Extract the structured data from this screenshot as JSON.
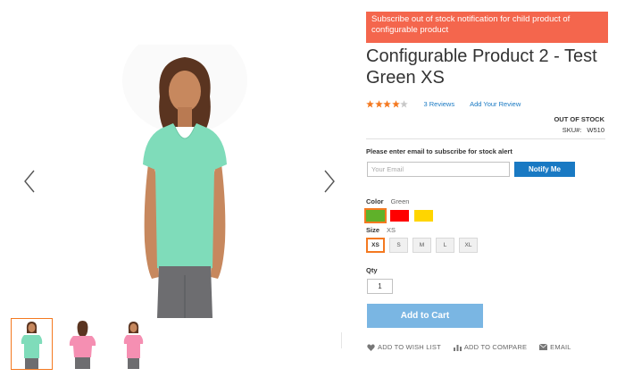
{
  "notice": "Subscribe out of stock notification for child product of configurable product",
  "product": {
    "title": "Configurable Product 2 - Test Green XS",
    "rating": {
      "filled": 4,
      "total": 5
    },
    "reviews_link": "3 Reviews",
    "add_review_link": "Add Your Review",
    "stock_status": "OUT OF STOCK",
    "sku_label": "SKU#:",
    "sku_value": "W510"
  },
  "stock_alert": {
    "label": "Please enter email to subscribe for stock alert",
    "email_placeholder": "Your Email",
    "email_value": "",
    "button": "Notify Me"
  },
  "color": {
    "label": "Color",
    "selected": "Green",
    "swatches": [
      {
        "name": "Green",
        "hex": "#5fb12a",
        "selected": true
      },
      {
        "name": "Red",
        "hex": "#ff0000",
        "selected": false
      },
      {
        "name": "Yellow",
        "hex": "#ffd500",
        "selected": false
      }
    ]
  },
  "size": {
    "label": "Size",
    "selected": "XS",
    "options": [
      "XS",
      "S",
      "M",
      "L",
      "XL"
    ]
  },
  "qty": {
    "label": "Qty",
    "value": "1"
  },
  "cart_button": "Add to Cart",
  "actions": {
    "wishlist": "ADD TO WISH LIST",
    "compare": "ADD TO COMPARE",
    "email": "EMAIL"
  },
  "gallery": {
    "thumbnails": [
      "green-tee-front",
      "pink-tee-back",
      "pink-tee-front"
    ],
    "active_thumbnail": 0
  },
  "colors": {
    "accent": "#f47920",
    "link": "#1979c3",
    "notice_bg": "#f4664d",
    "star": "#f47920"
  }
}
